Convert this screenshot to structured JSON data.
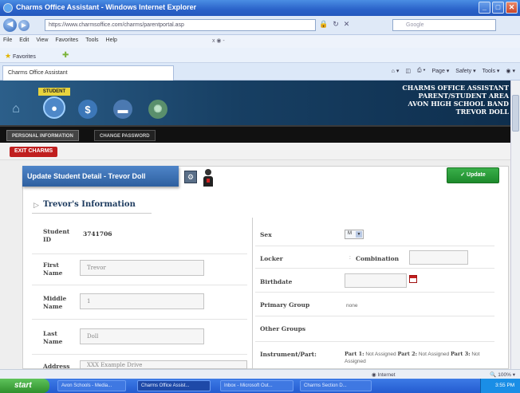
{
  "window": {
    "title": "Charms Office Assistant - Windows Internet Explorer",
    "controls": [
      "_",
      "□",
      "✕"
    ]
  },
  "browser": {
    "url": "https://www.charmsoffice.com/charms/parentportal.asp",
    "search_placeholder": "Google",
    "menu": [
      "File",
      "Edit",
      "View",
      "Favorites",
      "Tools",
      "Help"
    ],
    "menu_extra": "x  ◉ -",
    "favorites_label": "Favorites",
    "tab_label": "Charms Office Assistant",
    "command_bar": [
      "Page ▾",
      "Safety ▾",
      "Tools ▾",
      "◉ ▾"
    ]
  },
  "header": {
    "line1": "CHARMS OFFICE ASSISTANT",
    "line2": "PARENT/STUDENT AREA",
    "line3": "AVON HIGH SCHOOL BAND",
    "line4": "TREVOR DOLL",
    "student_info_label": "STUDENT INFO"
  },
  "tabs": {
    "personal": "PERSONAL INFORMATION",
    "password": "CHANGE PASSWORD"
  },
  "exit_label": "EXIT CHARMS",
  "update_panel": {
    "title": "Update Student Detail - Trevor Doll",
    "update_button": "✓ Update",
    "section_title": "Trevor's Information"
  },
  "left_fields": {
    "student_id_label": "Student ID",
    "student_id_value": "3741706",
    "first_label": "First Name",
    "first_value": "Trevor",
    "middle_label": "Middle Name",
    "middle_value": "1",
    "last_label": "Last Name",
    "last_value": "Doll",
    "address_label": "Address",
    "address_value": "XXX Example Drive"
  },
  "right_fields": {
    "sex_label": "Sex",
    "sex_value": "M",
    "locker_label": "Locker",
    "combination_label": "Combination",
    "birthdate_label": "Birthdate",
    "primary_group_label": "Primary Group",
    "primary_group_value": "none",
    "other_groups_label": "Other Groups",
    "instrument_label": "Instrument/Part:",
    "part1_label": "Part 1:",
    "part1_value": "Not Assigned",
    "part2_label": "Part 2:",
    "part2_value": "Not Assigned",
    "part3_label": "Part 3:",
    "part3_value": "Not Assigned"
  },
  "status": {
    "zone": "Internet",
    "zoom": "100%"
  },
  "taskbar": {
    "start": "start",
    "tasks": [
      "Avon Schools - Media...",
      "Charms Office Assist...",
      "Inbox - Microsoft Out...",
      "Charms Section D..."
    ],
    "clock": "3:55 PM"
  }
}
